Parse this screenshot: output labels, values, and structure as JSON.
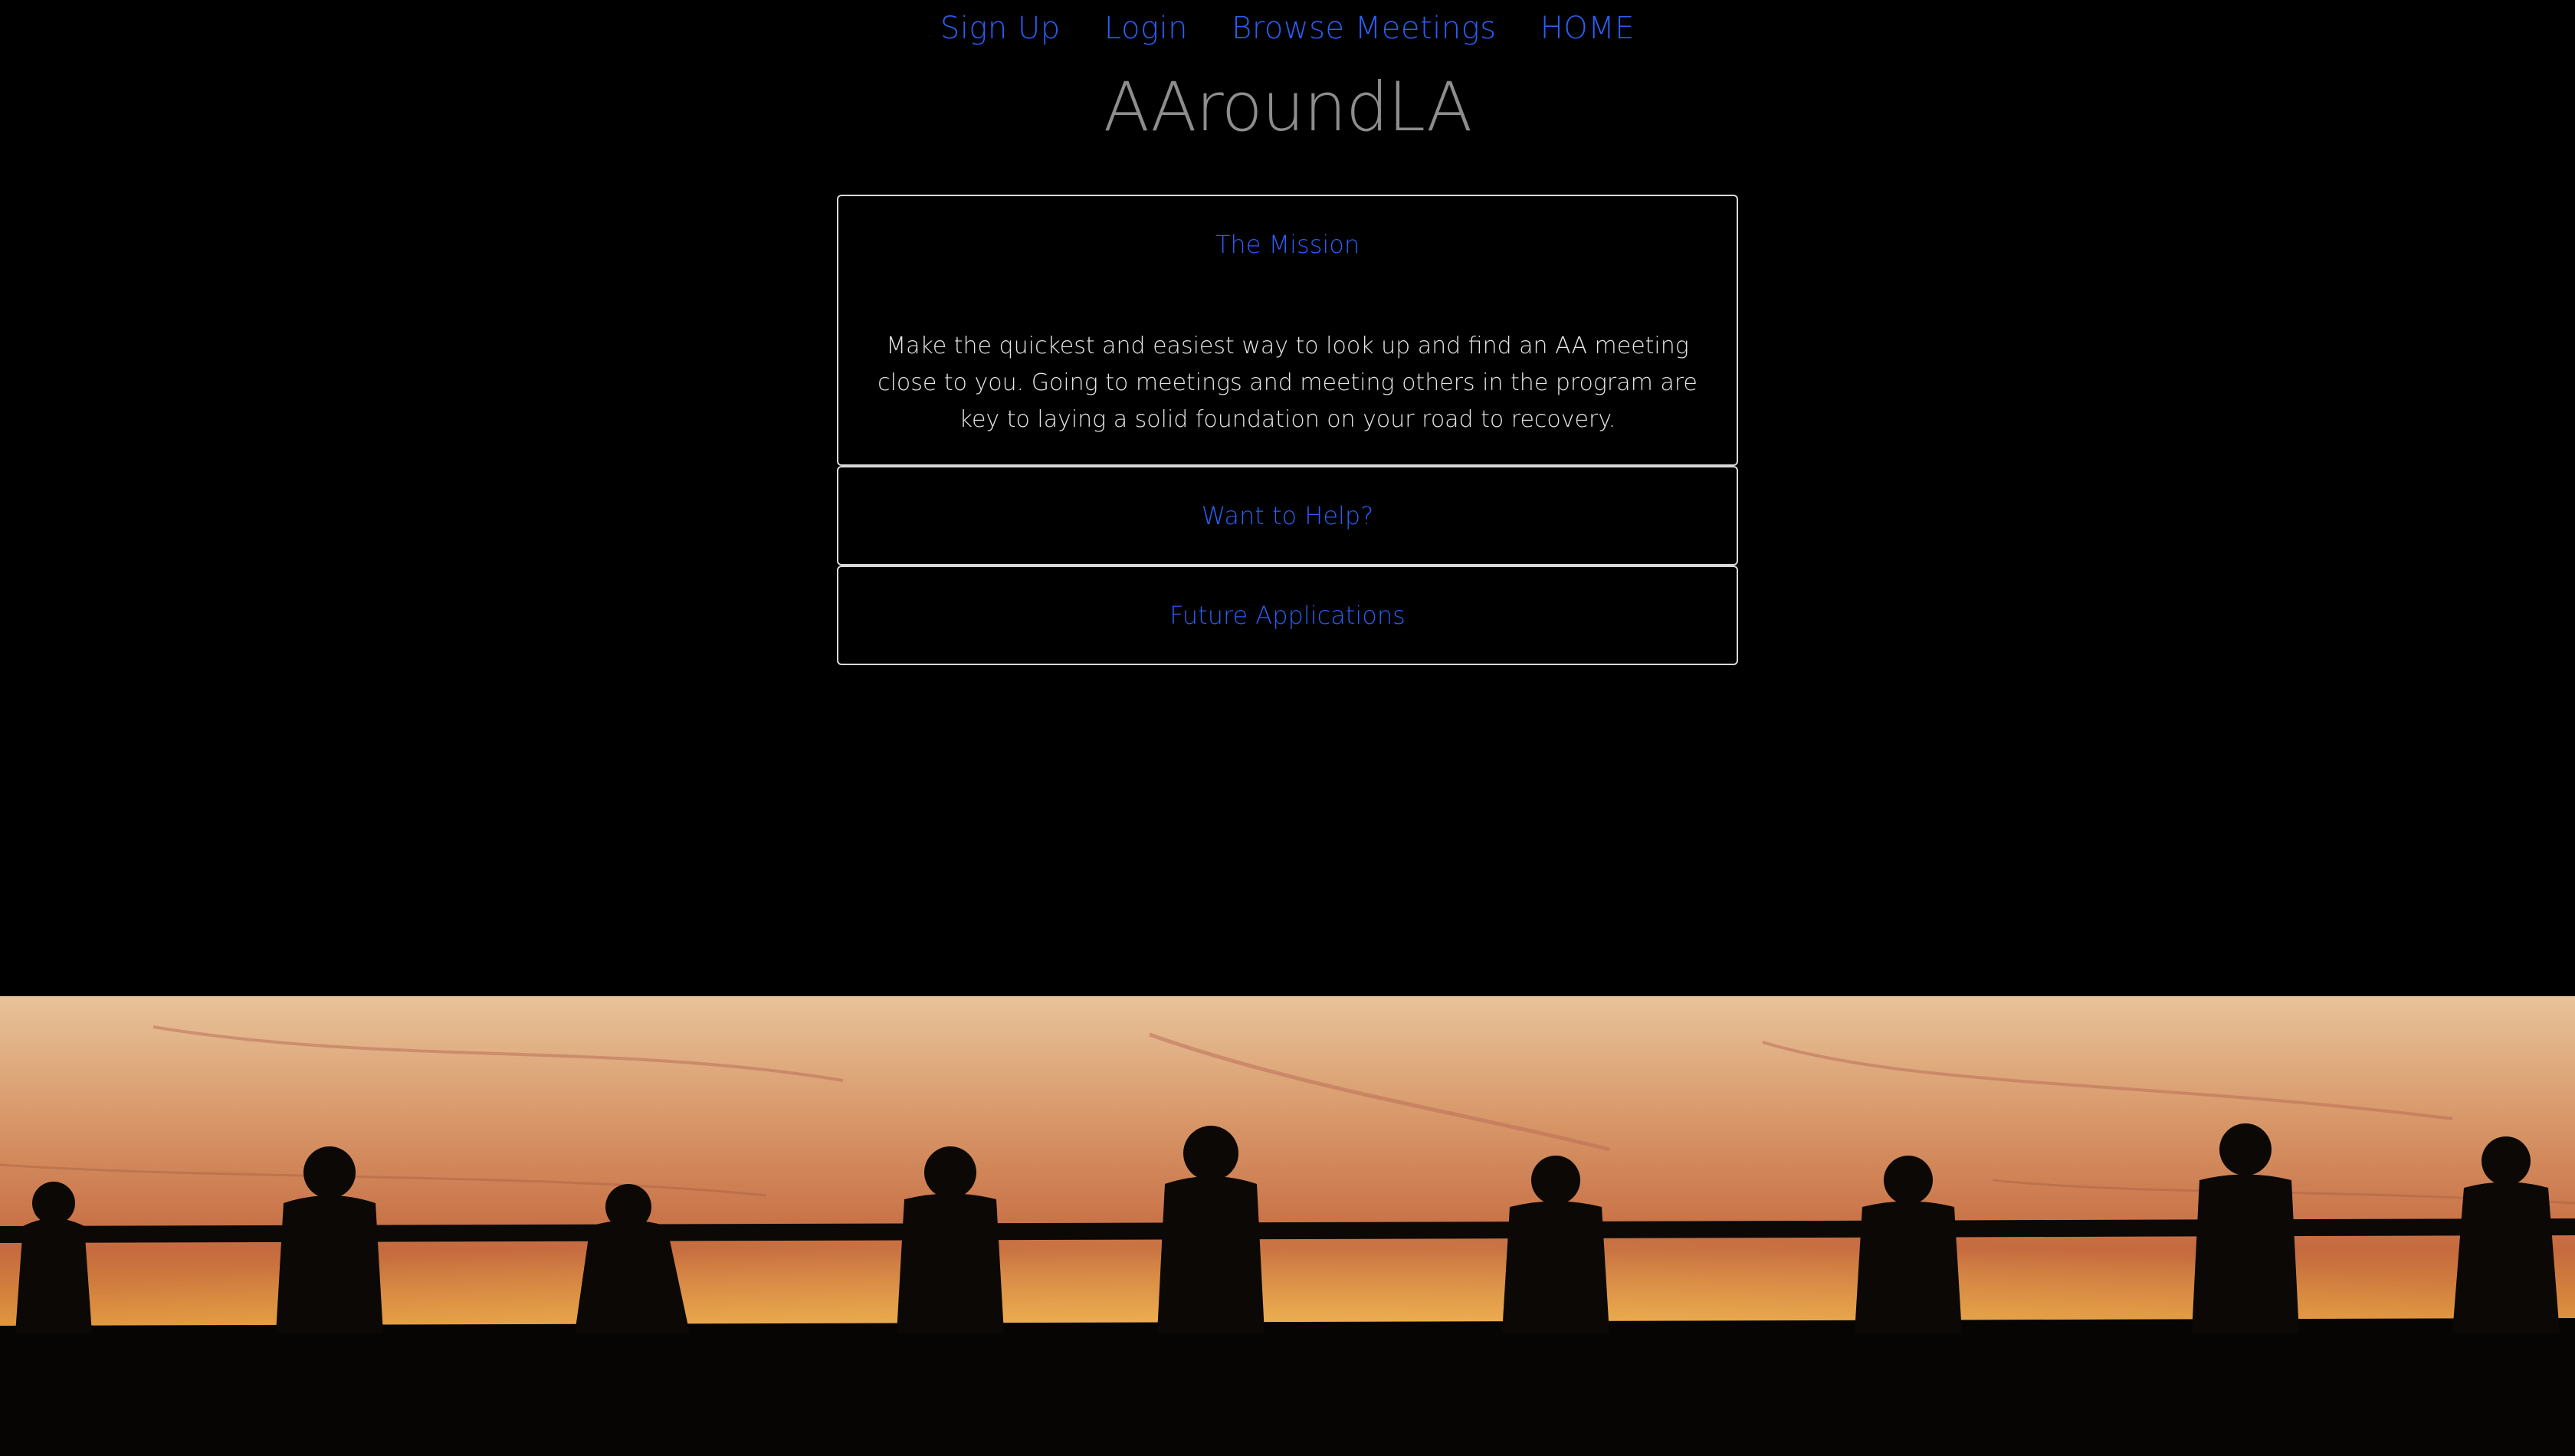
{
  "nav": {
    "links": [
      {
        "label": "Sign Up"
      },
      {
        "label": "Login"
      },
      {
        "label": "Browse Meetings"
      },
      {
        "label": "HOME"
      }
    ]
  },
  "brand": {
    "title": "AAroundLA"
  },
  "accordion": {
    "panels": [
      {
        "title": "The Mission",
        "body": "Make the quickest and easiest way to look up and find an AA meeting close to you. Going to meetings and meeting others in the program are key to laying a solid foundation on your road to recovery."
      },
      {
        "title": "Want to Help?"
      },
      {
        "title": "Future Applications"
      }
    ]
  },
  "colors": {
    "link": "#2a5ef5",
    "brand": "#8d8d8d",
    "background": "#000000",
    "panel_border": "#d9d9d9"
  },
  "hero": {
    "image": "people-holding-hands-sunset-silhouette"
  }
}
